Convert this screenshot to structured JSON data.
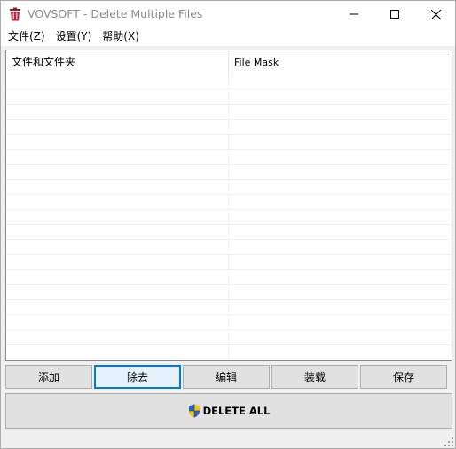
{
  "window": {
    "title": "VOVSOFT - Delete Multiple Files",
    "icon": "trash-bin-icon"
  },
  "menu": {
    "items": [
      {
        "label": "文件(Z)"
      },
      {
        "label": "设置(Y)"
      },
      {
        "label": "帮助(X)"
      }
    ]
  },
  "list": {
    "columns": [
      {
        "label": "文件和文件夹"
      },
      {
        "label": "File Mask"
      }
    ],
    "rows": []
  },
  "buttons": {
    "add": "添加",
    "remove": "除去",
    "edit": "编辑",
    "load": "装载",
    "save": "保存",
    "delete_all": "DELETE ALL"
  },
  "colors": {
    "focus_border": "#0078d7",
    "button_bg": "#e1e1e1",
    "window_bg": "#f0f0f0"
  }
}
